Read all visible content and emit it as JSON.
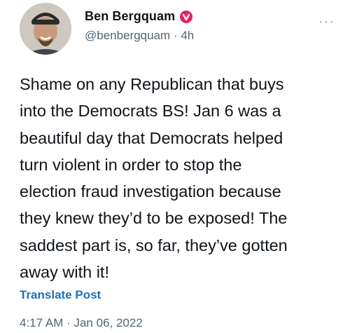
{
  "author": {
    "display_name": "Ben Bergquam",
    "handle": "@benbergquam",
    "separator": "·",
    "time_ago": "4h",
    "badge_color": "#e0245e"
  },
  "more_label": "···",
  "tweet": {
    "lines": [
      "Shame on any Republican that buys",
      "into the Democrats BS! Jan 6 was a",
      "beautiful day that Democrats helped",
      "turn violent in order to stop the",
      "election fraud investigation because",
      "they knew they’d to be exposed! The",
      "saddest part is, so far, they’ve gotten",
      "away with it!"
    ]
  },
  "translate_label": "Translate Post",
  "timestamp": "4:17 AM · Jan 06, 2022"
}
